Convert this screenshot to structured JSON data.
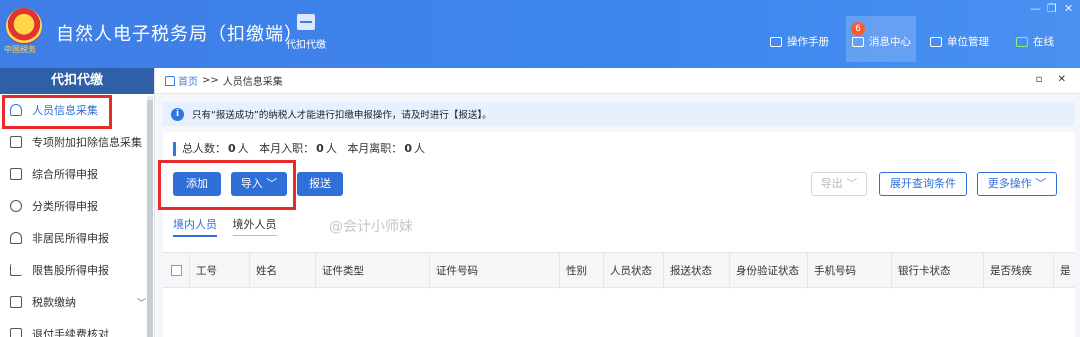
{
  "header": {
    "emblem_text": "中国税务",
    "app_title": "自然人电子税务局（扣缴端）",
    "module_tab": "代扣代缴",
    "actions": [
      {
        "label": "操作手册",
        "icon": "book-icon"
      },
      {
        "label": "消息中心",
        "icon": "mail-icon",
        "badge": "6"
      },
      {
        "label": "单位管理",
        "icon": "building-icon"
      },
      {
        "label": "在线",
        "icon": "online-icon"
      }
    ],
    "window_controls": [
      "—",
      "❐",
      "✕"
    ]
  },
  "sidebar": {
    "title": "代扣代缴",
    "items": [
      {
        "label": "人员信息采集",
        "icon": "person-icon",
        "active": true
      },
      {
        "label": "专项附加扣除信息采集",
        "icon": "list-icon"
      },
      {
        "label": "综合所得申报",
        "icon": "layers-icon"
      },
      {
        "label": "分类所得申报",
        "icon": "pie-icon"
      },
      {
        "label": "非居民所得申报",
        "icon": "user-icon"
      },
      {
        "label": "限售股所得申报",
        "icon": "bar-chart-icon"
      },
      {
        "label": "税款缴纳",
        "icon": "wallet-icon",
        "has_chevron": true
      },
      {
        "label": "退付手续费核对",
        "icon": "doc-icon"
      }
    ]
  },
  "breadcrumb": {
    "home": "首页",
    "separator": ">>",
    "current": "人员信息采集",
    "tools": "▫ ✕"
  },
  "notice": {
    "icon": "i",
    "text": "只有“报送成功”的纳税人才能进行扣缴申报操作，请及时进行【报送】。"
  },
  "stats": {
    "total_label": "总人数：",
    "total_value": "0",
    "unit": "人",
    "joined_label": "本月入职：",
    "joined_value": "0",
    "left_label": "本月离职：",
    "left_value": "0"
  },
  "toolbar": {
    "add": "添加",
    "import": "导入 ﹀",
    "submit": "报送",
    "export": "导出 ﹀",
    "expand_query": "展开查询条件",
    "more": "更多操作 ﹀"
  },
  "subtabs": [
    "境内人员",
    "境外人员"
  ],
  "watermark": "@会计小师妹",
  "table": {
    "columns": [
      "工号",
      "姓名",
      "证件类型",
      "证件号码",
      "性别",
      "人员状态",
      "报送状态",
      "身份验证状态",
      "手机号码",
      "银行卡状态",
      "是否残疾",
      "是"
    ]
  },
  "colors": {
    "header_blue": "#3f7ee6",
    "sidebar_head": "#2f5fa7",
    "primary": "#2f6fd8",
    "highlight_red": "#e82a2a"
  }
}
